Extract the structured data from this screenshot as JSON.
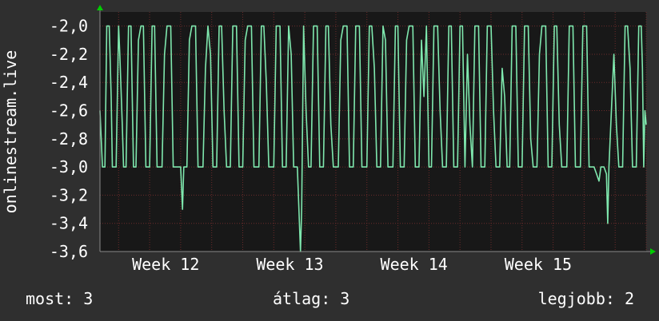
{
  "chart_data": {
    "type": "line",
    "ylabel": "onlinestream.live",
    "ylim": [
      -3.6,
      -1.9
    ],
    "y_ticks": [
      -2.0,
      -2.2,
      -2.4,
      -2.6,
      -2.8,
      -3.0,
      -3.2,
      -3.4,
      -3.6
    ],
    "y_tick_labels": [
      "-2,0",
      "-2,2",
      "-2,4",
      "-2,6",
      "-2,8",
      "-3,0",
      "-3,2",
      "-3,4",
      "-3,6"
    ],
    "x_range_weeks": [
      11.6,
      16.0
    ],
    "x_ticks": [
      {
        "label": "Week 12",
        "week": 12
      },
      {
        "label": "Week 13",
        "week": 13
      },
      {
        "label": "Week 14",
        "week": 14
      },
      {
        "label": "Week 15",
        "week": 15
      }
    ],
    "grid": true,
    "colors": {
      "background": "#2f2f2f",
      "plot_area": "#181818",
      "line": "#7fe8ae",
      "grid": "#6b2a2a",
      "axis_arrow": "#00cc00",
      "text": "#ffffff"
    },
    "series": [
      {
        "points": [
          [
            11.6,
            -2.6
          ],
          [
            11.62,
            -3.0
          ],
          [
            11.64,
            -3.0
          ],
          [
            11.655,
            -2.0
          ],
          [
            11.675,
            -2.0
          ],
          [
            11.69,
            -2.5
          ],
          [
            11.7,
            -3.0
          ],
          [
            11.73,
            -3.0
          ],
          [
            11.75,
            -2.0
          ],
          [
            11.76,
            -2.2
          ],
          [
            11.78,
            -2.7
          ],
          [
            11.79,
            -3.0
          ],
          [
            11.81,
            -3.0
          ],
          [
            11.83,
            -2.0
          ],
          [
            11.85,
            -2.0
          ],
          [
            11.87,
            -3.0
          ],
          [
            11.89,
            -3.0
          ],
          [
            11.91,
            -2.1
          ],
          [
            11.93,
            -2.0
          ],
          [
            11.95,
            -2.0
          ],
          [
            11.97,
            -3.0
          ],
          [
            12.0,
            -3.0
          ],
          [
            12.02,
            -2.0
          ],
          [
            12.04,
            -2.0
          ],
          [
            12.06,
            -3.0
          ],
          [
            12.1,
            -3.0
          ],
          [
            12.12,
            -2.2
          ],
          [
            12.14,
            -2.0
          ],
          [
            12.17,
            -2.0
          ],
          [
            12.19,
            -3.0
          ],
          [
            12.25,
            -3.0
          ],
          [
            12.265,
            -3.3
          ],
          [
            12.275,
            -3.0
          ],
          [
            12.3,
            -3.0
          ],
          [
            12.32,
            -2.1
          ],
          [
            12.34,
            -2.0
          ],
          [
            12.37,
            -2.0
          ],
          [
            12.39,
            -3.0
          ],
          [
            12.43,
            -3.0
          ],
          [
            12.45,
            -2.3
          ],
          [
            12.47,
            -2.0
          ],
          [
            12.49,
            -2.2
          ],
          [
            12.51,
            -3.0
          ],
          [
            12.54,
            -3.0
          ],
          [
            12.56,
            -2.0
          ],
          [
            12.58,
            -2.0
          ],
          [
            12.6,
            -2.6
          ],
          [
            12.62,
            -3.0
          ],
          [
            12.65,
            -3.0
          ],
          [
            12.67,
            -2.0
          ],
          [
            12.7,
            -2.0
          ],
          [
            12.72,
            -3.0
          ],
          [
            12.75,
            -3.0
          ],
          [
            12.77,
            -2.1
          ],
          [
            12.79,
            -2.0
          ],
          [
            12.82,
            -2.0
          ],
          [
            12.84,
            -3.0
          ],
          [
            12.88,
            -3.0
          ],
          [
            12.9,
            -2.0
          ],
          [
            12.92,
            -2.0
          ],
          [
            12.94,
            -2.4
          ],
          [
            12.96,
            -3.0
          ],
          [
            13.0,
            -3.0
          ],
          [
            13.02,
            -2.0
          ],
          [
            13.05,
            -2.0
          ],
          [
            13.07,
            -3.0
          ],
          [
            13.1,
            -3.0
          ],
          [
            13.12,
            -2.0
          ],
          [
            13.14,
            -2.2
          ],
          [
            13.16,
            -3.0
          ],
          [
            13.19,
            -3.0
          ],
          [
            13.215,
            -3.6
          ],
          [
            13.225,
            -3.3
          ],
          [
            13.24,
            -2.0
          ],
          [
            13.26,
            -2.6
          ],
          [
            13.28,
            -3.0
          ],
          [
            13.3,
            -3.0
          ],
          [
            13.32,
            -2.0
          ],
          [
            13.35,
            -2.0
          ],
          [
            13.37,
            -3.0
          ],
          [
            13.4,
            -3.0
          ],
          [
            13.42,
            -2.0
          ],
          [
            13.44,
            -2.0
          ],
          [
            13.46,
            -2.7
          ],
          [
            13.48,
            -3.0
          ],
          [
            13.52,
            -3.0
          ],
          [
            13.54,
            -2.1
          ],
          [
            13.56,
            -2.0
          ],
          [
            13.59,
            -2.0
          ],
          [
            13.61,
            -3.0
          ],
          [
            13.64,
            -3.0
          ],
          [
            13.66,
            -2.0
          ],
          [
            13.69,
            -2.0
          ],
          [
            13.71,
            -3.0
          ],
          [
            13.75,
            -3.0
          ],
          [
            13.77,
            -2.0
          ],
          [
            13.79,
            -2.0
          ],
          [
            13.81,
            -2.3
          ],
          [
            13.83,
            -3.0
          ],
          [
            13.86,
            -3.0
          ],
          [
            13.88,
            -2.0
          ],
          [
            13.9,
            -2.1
          ],
          [
            13.92,
            -3.0
          ],
          [
            13.96,
            -3.0
          ],
          [
            13.98,
            -2.0
          ],
          [
            14.0,
            -2.0
          ],
          [
            14.02,
            -3.0
          ],
          [
            14.05,
            -3.0
          ],
          [
            14.07,
            -2.1
          ],
          [
            14.09,
            -2.0
          ],
          [
            14.12,
            -2.0
          ],
          [
            14.14,
            -3.0
          ],
          [
            14.17,
            -3.0
          ],
          [
            14.19,
            -2.1
          ],
          [
            14.21,
            -2.5
          ],
          [
            14.23,
            -2.0
          ],
          [
            14.25,
            -3.0
          ],
          [
            14.27,
            -3.0
          ],
          [
            14.29,
            -2.0
          ],
          [
            14.32,
            -2.0
          ],
          [
            14.34,
            -2.6
          ],
          [
            14.36,
            -3.0
          ],
          [
            14.39,
            -3.0
          ],
          [
            14.41,
            -2.0
          ],
          [
            14.43,
            -2.0
          ],
          [
            14.45,
            -3.0
          ],
          [
            14.48,
            -3.0
          ],
          [
            14.5,
            -2.0
          ],
          [
            14.52,
            -2.0
          ],
          [
            14.54,
            -3.0
          ],
          [
            14.56,
            -2.2
          ],
          [
            14.58,
            -2.7
          ],
          [
            14.6,
            -3.0
          ],
          [
            14.62,
            -2.0
          ],
          [
            14.65,
            -2.0
          ],
          [
            14.67,
            -3.0
          ],
          [
            14.7,
            -3.0
          ],
          [
            14.72,
            -2.0
          ],
          [
            14.75,
            -2.0
          ],
          [
            14.77,
            -2.6
          ],
          [
            14.79,
            -3.0
          ],
          [
            14.82,
            -3.0
          ],
          [
            14.84,
            -2.3
          ],
          [
            14.86,
            -2.5
          ],
          [
            14.88,
            -3.0
          ],
          [
            14.9,
            -3.0
          ],
          [
            14.92,
            -2.0
          ],
          [
            14.95,
            -2.0
          ],
          [
            14.97,
            -3.0
          ],
          [
            15.0,
            -3.0
          ],
          [
            15.02,
            -2.0
          ],
          [
            15.05,
            -2.0
          ],
          [
            15.07,
            -2.8
          ],
          [
            15.09,
            -3.0
          ],
          [
            15.12,
            -3.0
          ],
          [
            15.14,
            -2.2
          ],
          [
            15.16,
            -2.0
          ],
          [
            15.19,
            -2.0
          ],
          [
            15.21,
            -3.0
          ],
          [
            15.24,
            -3.0
          ],
          [
            15.26,
            -2.0
          ],
          [
            15.28,
            -2.0
          ],
          [
            15.3,
            -2.7
          ],
          [
            15.32,
            -3.0
          ],
          [
            15.36,
            -3.0
          ],
          [
            15.38,
            -2.0
          ],
          [
            15.41,
            -2.0
          ],
          [
            15.43,
            -3.0
          ],
          [
            15.47,
            -3.0
          ],
          [
            15.49,
            -2.0
          ],
          [
            15.52,
            -2.0
          ],
          [
            15.54,
            -3.0
          ],
          [
            15.58,
            -3.0
          ],
          [
            15.6,
            -3.05
          ],
          [
            15.62,
            -3.1
          ],
          [
            15.635,
            -3.0
          ],
          [
            15.66,
            -3.0
          ],
          [
            15.68,
            -3.05
          ],
          [
            15.69,
            -3.4
          ],
          [
            15.7,
            -3.0
          ],
          [
            15.72,
            -2.6
          ],
          [
            15.74,
            -2.2
          ],
          [
            15.76,
            -2.7
          ],
          [
            15.78,
            -3.0
          ],
          [
            15.81,
            -3.0
          ],
          [
            15.83,
            -2.0
          ],
          [
            15.85,
            -2.0
          ],
          [
            15.87,
            -2.3
          ],
          [
            15.89,
            -3.0
          ],
          [
            15.92,
            -3.0
          ],
          [
            15.94,
            -2.0
          ],
          [
            15.96,
            -2.0
          ],
          [
            15.97,
            -2.3
          ],
          [
            15.98,
            -3.0
          ],
          [
            15.99,
            -2.6
          ],
          [
            16.0,
            -2.7
          ]
        ]
      }
    ]
  },
  "footer": {
    "now_text": "most: 3",
    "avg_text": "átlag: 3",
    "best_text": "legjobb: 2"
  }
}
